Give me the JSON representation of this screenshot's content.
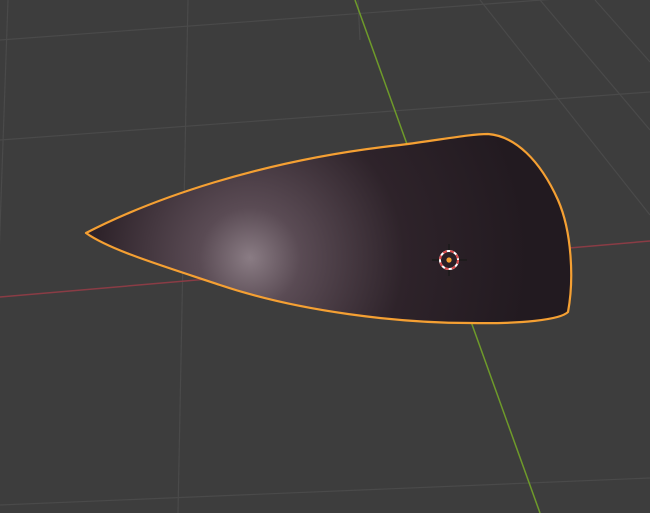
{
  "viewport": {
    "name": "3D Viewport",
    "background_color": "#3d3d3d",
    "grid_color": "#4a4a4a",
    "x_axis_color": "#8a3c45",
    "y_axis_color": "#6e9a2a"
  },
  "selected_object": {
    "selection_outline_color": "#f5a033",
    "shading_colors": [
      "#2a1f26",
      "#4a3c44",
      "#8a7c84"
    ],
    "origin_color": "#f5a033"
  },
  "cursor_3d": {
    "ring_colors": [
      "#d94a4a",
      "#ffffff"
    ]
  }
}
